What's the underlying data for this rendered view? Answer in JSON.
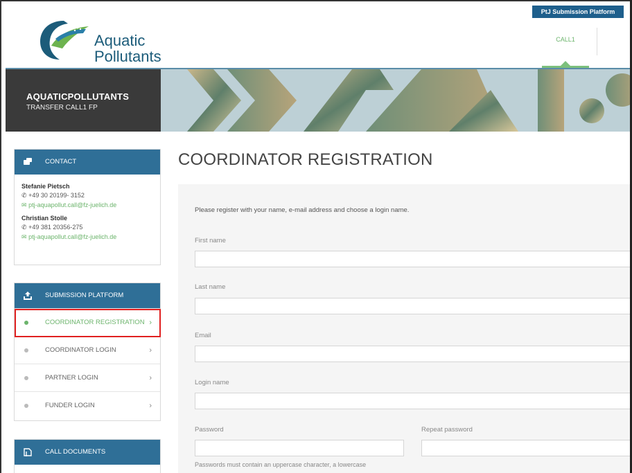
{
  "header": {
    "logo_line1": "Aquatic",
    "logo_line2": "Pollutants",
    "platform_tab": "PtJ Submission Platform",
    "call_tab": "CALL1"
  },
  "banner": {
    "title": "AQUATICPOLLUTANTS",
    "subtitle": "TRANSFER CALL1 FP"
  },
  "contact": {
    "heading": "CONTACT",
    "people": [
      {
        "name": "Stefanie Pietsch",
        "phone": "+49 30 20199- 3152",
        "email": "ptj-aquapollut.call@fz-juelich.de"
      },
      {
        "name": "Christian Stolle",
        "phone": "+49 381 20356-275",
        "email": "ptj-aquapollut.call@fz-juelich.de"
      }
    ]
  },
  "submission": {
    "heading": "SUBMISSION PLATFORM",
    "items": [
      {
        "label": "COORDINATOR REGISTRATION"
      },
      {
        "label": "COORDINATOR LOGIN"
      },
      {
        "label": "PARTNER LOGIN"
      },
      {
        "label": "FUNDER LOGIN"
      }
    ]
  },
  "documents": {
    "heading": "CALL DOCUMENTS"
  },
  "main": {
    "title": "COORDINATOR REGISTRATION",
    "intro": "Please register with your name, e-mail address and choose a login name.",
    "fields": {
      "first_name": "First name",
      "last_name": "Last name",
      "email": "Email",
      "login_name": "Login name",
      "password": "Password",
      "repeat_password": "Repeat password"
    },
    "password_hint": "Passwords must contain an uppercase character, a lowercase"
  },
  "colors": {
    "primary": "#2f6f97",
    "accent_green": "#6cb46c",
    "highlight_red": "#e02020",
    "banner_dark": "#3a3a3a"
  }
}
